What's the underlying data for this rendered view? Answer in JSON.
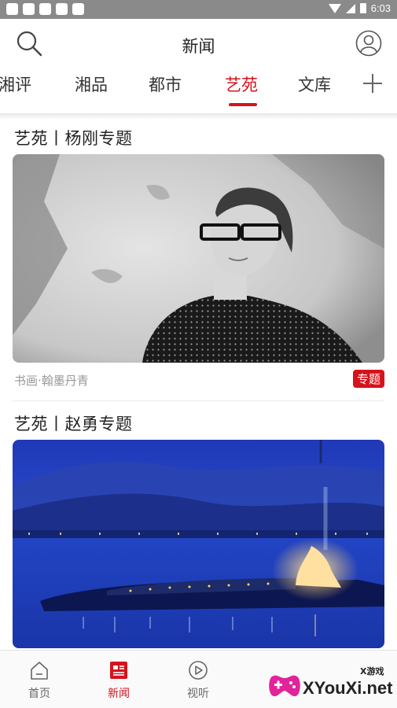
{
  "status_bar": {
    "time": "6:03"
  },
  "header": {
    "title": "新闻"
  },
  "tabs": [
    {
      "label": "湘评",
      "active": false
    },
    {
      "label": "湘品",
      "active": false
    },
    {
      "label": "都市",
      "active": false
    },
    {
      "label": "艺苑",
      "active": true
    },
    {
      "label": "文库",
      "active": false
    }
  ],
  "articles": [
    {
      "title": "艺苑丨杨刚专题",
      "source": "书画·翰墨丹青",
      "badge": "专题"
    },
    {
      "title": "艺苑丨赵勇专题"
    }
  ],
  "bottom_nav": [
    {
      "label": "首页",
      "icon": "home-icon",
      "active": false
    },
    {
      "label": "新闻",
      "icon": "news-icon",
      "active": true
    },
    {
      "label": "视听",
      "icon": "play-icon",
      "active": false
    }
  ],
  "watermark": {
    "text": "XYouXi.net",
    "small": "X游戏"
  },
  "colors": {
    "accent": "#d5131c",
    "status_bar": "#8a8a8a"
  }
}
